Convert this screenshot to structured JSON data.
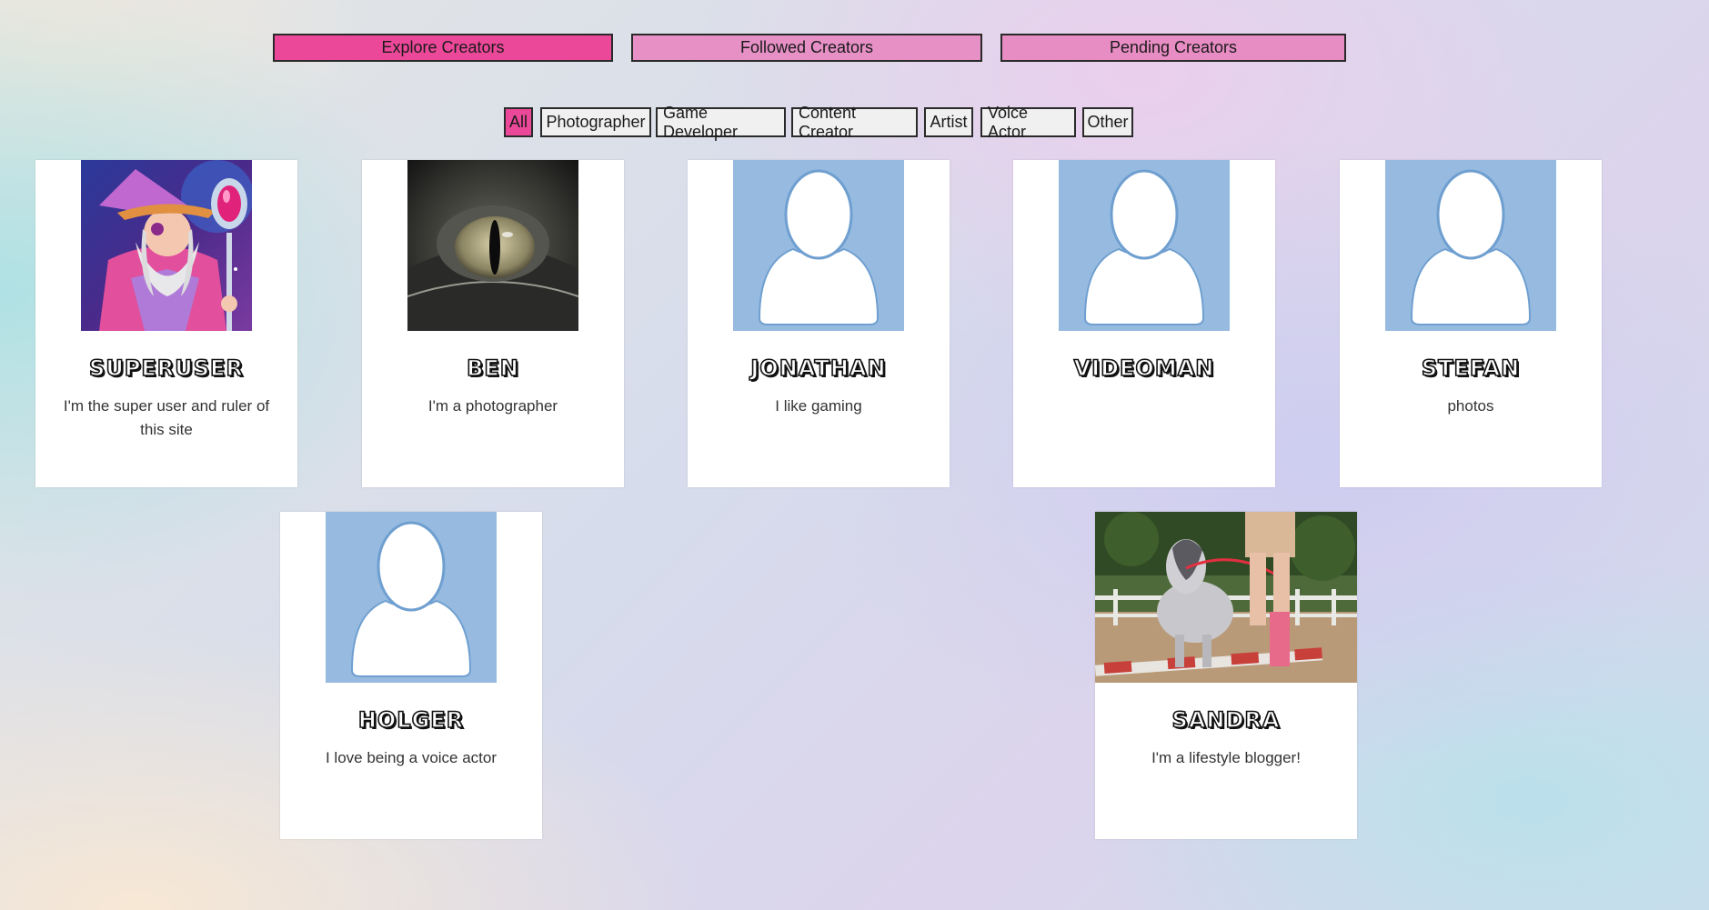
{
  "tabs": {
    "explore": "Explore Creators",
    "followed": "Followed Creators",
    "pending": "Pending Creators"
  },
  "filters": [
    "All",
    "Photographer",
    "Game Developer",
    "Content Creator",
    "Artist",
    "Voice Actor",
    "Other"
  ],
  "active_filter": "All",
  "colors": {
    "accent": "#ec4899",
    "tab_inactive": "#e690c6",
    "placeholder_avatar": "#97bbe0"
  },
  "creators": [
    {
      "name": "SUPERUSER",
      "description": "I'm the super user and ruler of this site",
      "avatar": "wizard-avatar"
    },
    {
      "name": "BEN",
      "description": "I'm a photographer",
      "avatar": "reptile-eye-photo"
    },
    {
      "name": "JONATHAN",
      "description": "I like gaming",
      "avatar": "default-user-avatar"
    },
    {
      "name": "VIDEOMAN",
      "description": "",
      "avatar": "default-user-avatar"
    },
    {
      "name": "STEFAN",
      "description": "photos",
      "avatar": "default-user-avatar"
    },
    {
      "name": "HOLGER",
      "description": "I love being a voice actor",
      "avatar": "default-user-avatar"
    },
    {
      "name": "SANDRA",
      "description": "I'm a lifestyle blogger!",
      "avatar": "pony-photo"
    }
  ]
}
